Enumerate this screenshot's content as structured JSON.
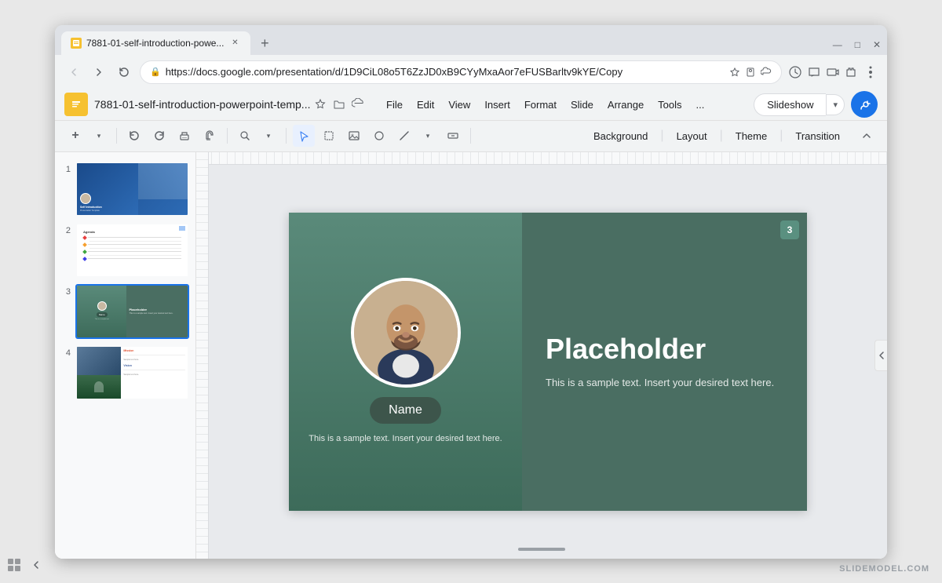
{
  "browser": {
    "tab_title": "7881-01-self-introduction-powe...",
    "tab_new_label": "+",
    "url": "https://docs.google.com/presentation/d/1D9CiL08o5T6ZzJD0xB9CYyMxaAor7eFUSBarltv9kYE/Copy",
    "window_controls": {
      "minimize": "—",
      "maximize": "□",
      "close": "✕"
    },
    "nav": {
      "back": "←",
      "forward": "→",
      "reload": "↻"
    }
  },
  "app": {
    "title": "7881-01-self-introduction-powerpoint-temp...",
    "menu_items": [
      "File",
      "Edit",
      "View",
      "Insert",
      "Format",
      "Slide",
      "Arrange",
      "Tools",
      "..."
    ],
    "slideshow_button": "Slideshow",
    "share_icon": "👤+"
  },
  "toolbar": {
    "buttons": [
      "+",
      "↩",
      "↪",
      "🖨",
      "✂",
      "🔍",
      "↖",
      "⬚",
      "🖼",
      "⬟",
      "✏",
      "⬡"
    ],
    "right_buttons": [
      "Background",
      "Layout",
      "Theme",
      "Transition"
    ]
  },
  "slides": [
    {
      "number": "1",
      "label": "Self Introduction slide 1"
    },
    {
      "number": "2",
      "label": "Agenda slide 2"
    },
    {
      "number": "3",
      "label": "Placeholder slide 3",
      "active": true
    },
    {
      "number": "4",
      "label": "Mission Vision slide 4"
    }
  ],
  "current_slide": {
    "number": "3",
    "title": "Placeholder",
    "description": "This is a sample text. Insert your desired text here.",
    "name_label": "Name",
    "subtitle": "This is a sample text. Insert your desired text here."
  },
  "watermark": "SLIDEMODEL.COM"
}
